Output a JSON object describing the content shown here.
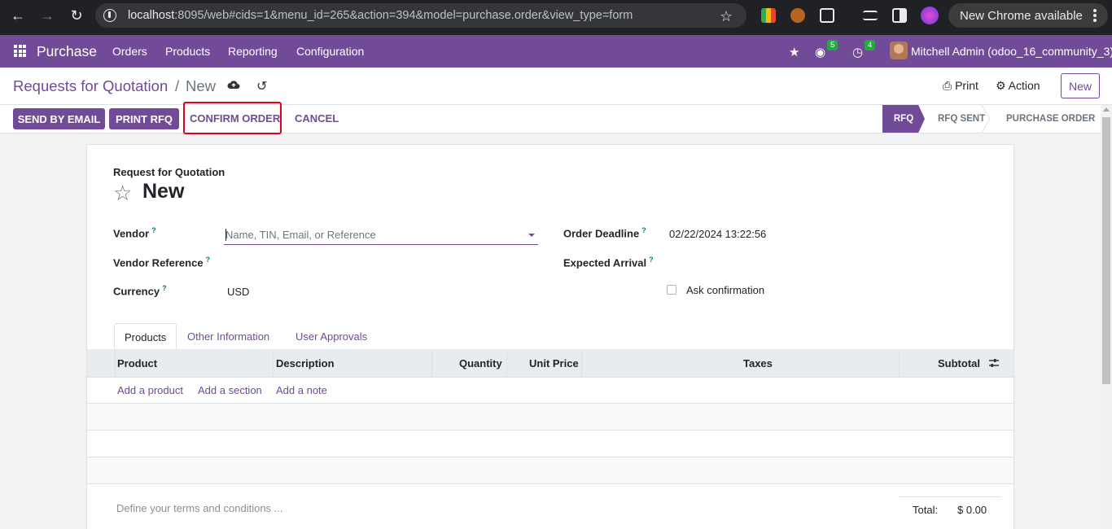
{
  "browser": {
    "url_host": "localhost",
    "url_rest": ":8095/web#cids=1&menu_id=265&action=394&model=purchase.order&view_type=form",
    "update_label": "New Chrome available"
  },
  "navbar": {
    "app_name": "Purchase",
    "menu": [
      "Orders",
      "Products",
      "Reporting",
      "Configuration"
    ],
    "messages_count": "5",
    "activities_count": "4",
    "user_name": "Mitchell Admin (odoo_16_community_3)"
  },
  "control_panel": {
    "breadcrumb_parent": "Requests for Quotation",
    "breadcrumb_sep": "/",
    "breadcrumb_current": "New",
    "print_label": "Print",
    "action_label": "Action",
    "new_label": "New"
  },
  "statusbar": {
    "buttons": {
      "send_by_email": "SEND BY EMAIL",
      "print_rfq": "PRINT RFQ",
      "confirm_order": "CONFIRM ORDER",
      "cancel": "CANCEL"
    },
    "stages": [
      "RFQ",
      "RFQ SENT",
      "PURCHASE ORDER"
    ],
    "active_stage": "RFQ"
  },
  "form": {
    "title_label": "Request for Quotation",
    "title": "New",
    "fields": {
      "vendor_label": "Vendor",
      "vendor_placeholder": "Name, TIN, Email, or Reference",
      "vendor_ref_label": "Vendor Reference",
      "currency_label": "Currency",
      "currency_value": "USD",
      "order_deadline_label": "Order Deadline",
      "order_deadline_value": "02/22/2024 13:22:56",
      "expected_arrival_label": "Expected Arrival",
      "ask_confirmation_label": "Ask confirmation",
      "ask_confirmation_checked": false
    },
    "tooltip_mark": "?",
    "tabs": [
      "Products",
      "Other Information",
      "User Approvals"
    ],
    "active_tab": "Products",
    "table": {
      "columns": [
        "Product",
        "Description",
        "Quantity",
        "Unit Price",
        "Taxes",
        "Subtotal"
      ],
      "add_links": [
        "Add a product",
        "Add a section",
        "Add a note"
      ]
    },
    "terms_placeholder": "Define your terms and conditions ...",
    "total_label": "Total:",
    "total_value": "$ 0.00"
  },
  "colors": {
    "brand": "#714b97",
    "chrome_bg": "#202124",
    "highlight": "#e3001b",
    "badge": "#28a745"
  }
}
